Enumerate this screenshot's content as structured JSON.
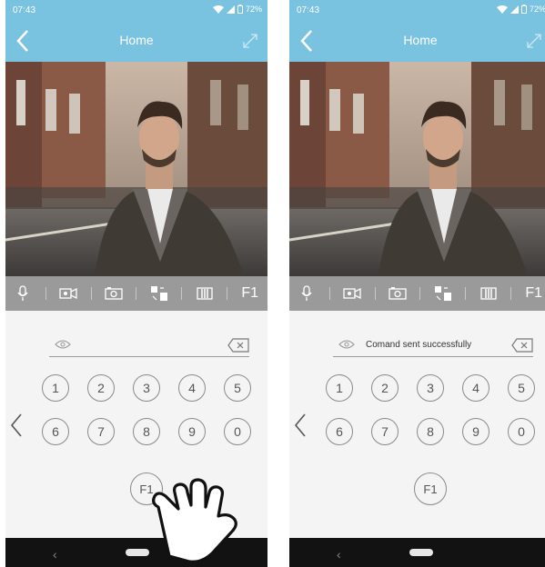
{
  "panels": [
    {
      "status": {
        "time": "07:43",
        "battery": "72%"
      },
      "title": "Home",
      "toolbar": {
        "f1_label": "F1"
      },
      "keypad": {
        "message": "",
        "row1": [
          "1",
          "2",
          "3",
          "4",
          "5"
        ],
        "row2": [
          "6",
          "7",
          "8",
          "9",
          "0"
        ],
        "f1": "F1"
      }
    },
    {
      "status": {
        "time": "07:43",
        "battery": "72%"
      },
      "title": "Home",
      "toolbar": {
        "f1_label": "F1"
      },
      "keypad": {
        "message": "Comand sent successfully",
        "row1": [
          "1",
          "2",
          "3",
          "4",
          "5"
        ],
        "row2": [
          "6",
          "7",
          "8",
          "9",
          "0"
        ],
        "f1": "F1"
      }
    }
  ],
  "icons": [
    "back-icon",
    "expand-icon",
    "mic-icon",
    "record-icon",
    "camera-icon",
    "gallery-icon",
    "gate-icon",
    "eye-icon",
    "backspace-icon",
    "chevron-left-icon",
    "hand-pointer-icon"
  ],
  "colors": {
    "appbar": "#79c2e0",
    "toolbar": "#9a9a9a",
    "background": "#f4f4f4",
    "navbar": "#121212"
  }
}
